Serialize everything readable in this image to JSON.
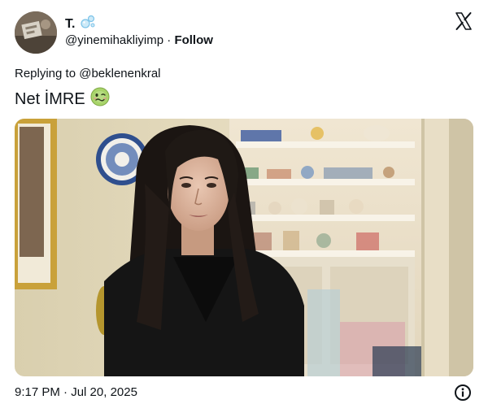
{
  "author": {
    "display_name": "T.",
    "handle": "@yinemihakliyimp",
    "follow_label": "Follow",
    "separator": "·"
  },
  "reply": {
    "prefix": "Replying to",
    "mention": "@beklenenkral"
  },
  "tweet": {
    "text": "Net İMRE",
    "emoji": "🥴"
  },
  "meta": {
    "time": "9:17 PM",
    "separator": "·",
    "date": "Jul 20, 2025"
  },
  "icons": {
    "brand": "x-logo-icon",
    "badge": "bubbles-icon",
    "info": "info-icon"
  },
  "colors": {
    "text": "#0f1419",
    "background": "#ffffff"
  }
}
